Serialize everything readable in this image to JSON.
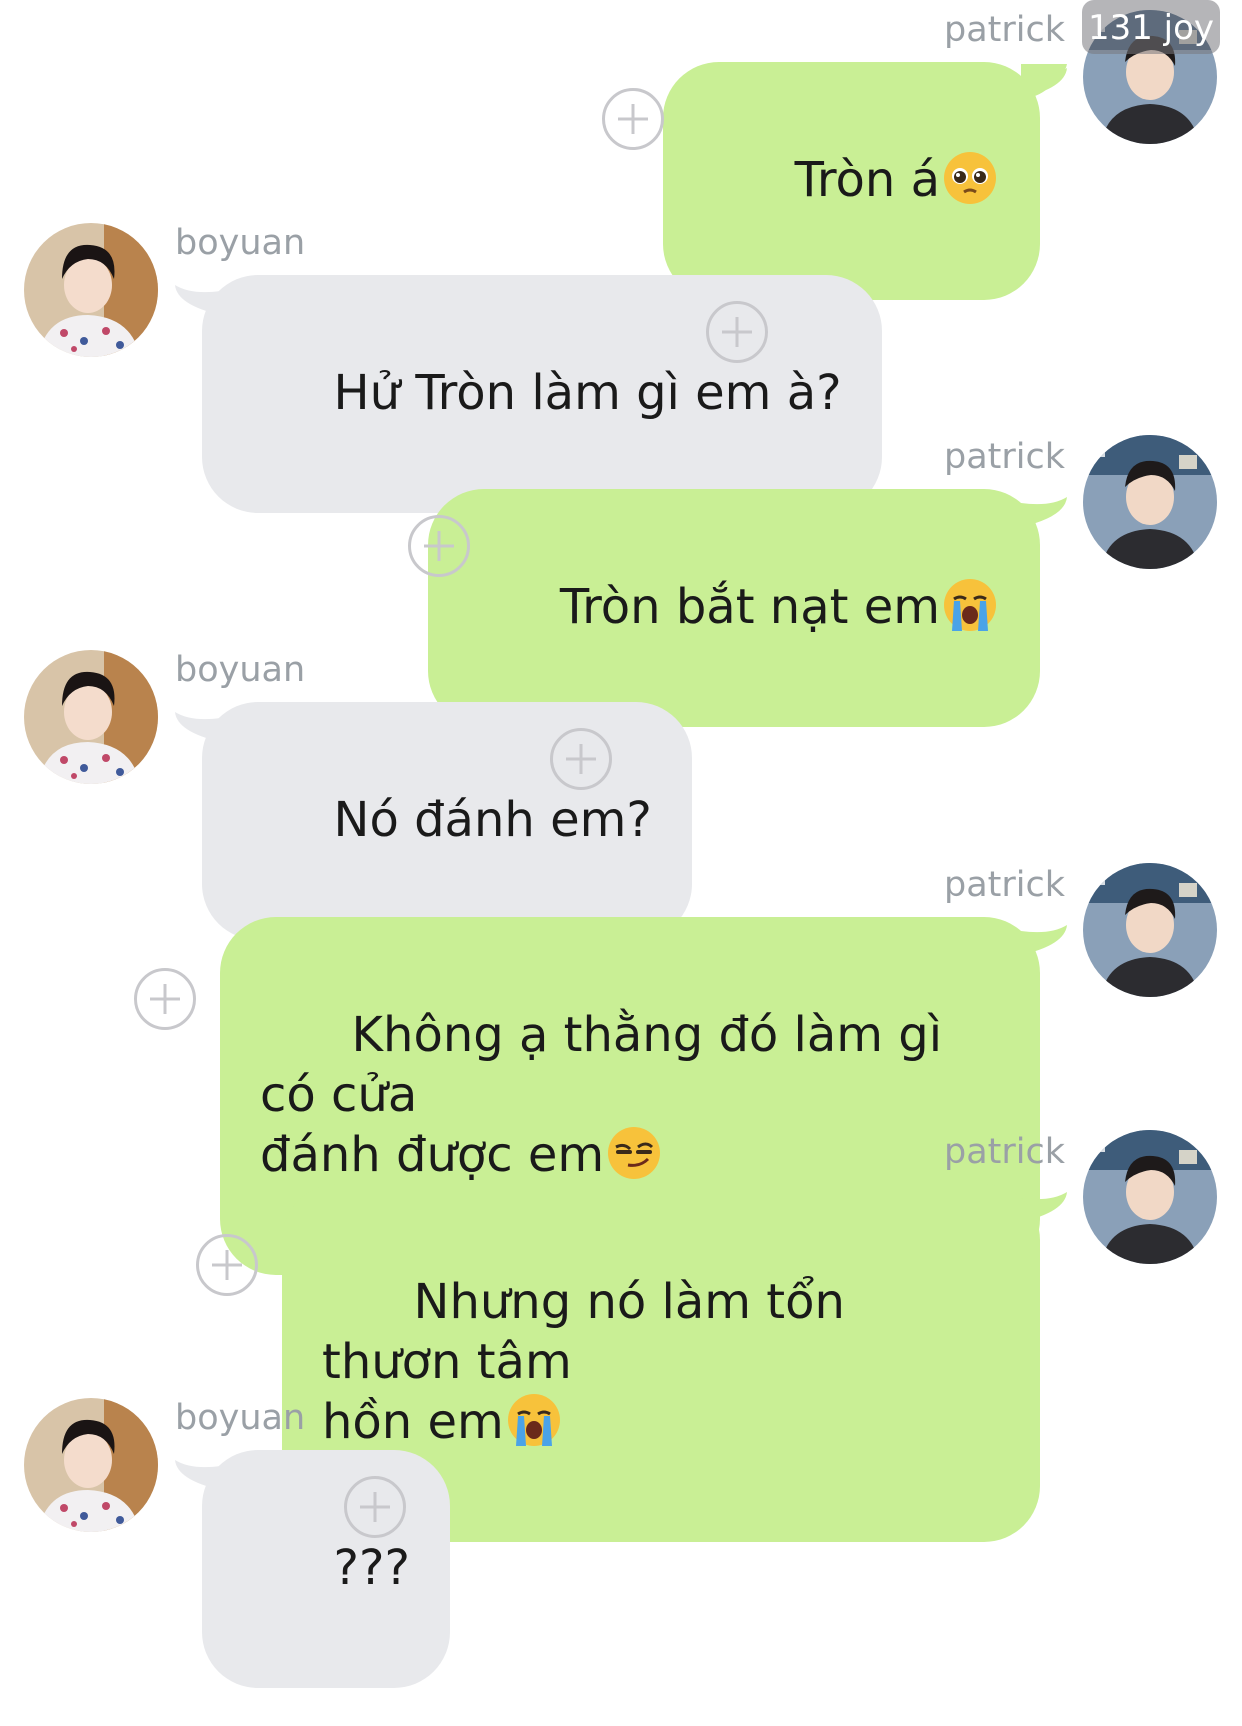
{
  "colors": {
    "outgoing_bubble": "#c9ef95",
    "incoming_bubble": "#e8e9ec",
    "sender_name": "#9aa0a6",
    "plus_icon": "#c8c8cc",
    "background": "#ffffff"
  },
  "overlay_badge": "131 joy",
  "messages": [
    {
      "sender": "patrick",
      "side": "right",
      "text": "Tròn á",
      "emoji": "pleading-face-emoji"
    },
    {
      "sender": "boyuan",
      "side": "left",
      "text": "Hử Tròn làm gì em à?",
      "emoji": ""
    },
    {
      "sender": "patrick",
      "side": "right",
      "text": "Tròn bắt nạt em",
      "emoji": "loudly-crying-face-emoji"
    },
    {
      "sender": "boyuan",
      "side": "left",
      "text": "Nó đánh em?",
      "emoji": ""
    },
    {
      "sender": "patrick",
      "side": "right",
      "text": "Không ạ thằng đó làm gì có cửa\nđánh được em",
      "emoji": "smirking-face-emoji"
    },
    {
      "sender": "patrick",
      "side": "right",
      "text": "Nhưng nó làm tổn thươn tâm\nhồn em",
      "emoji": "loudly-crying-face-emoji"
    },
    {
      "sender": "boyuan",
      "side": "left",
      "text": "???",
      "emoji": ""
    }
  ],
  "icons": {
    "add_reaction": "plus-circle-icon",
    "patrick_avatar": "avatar-patrick",
    "boyuan_avatar": "avatar-boyuan"
  }
}
